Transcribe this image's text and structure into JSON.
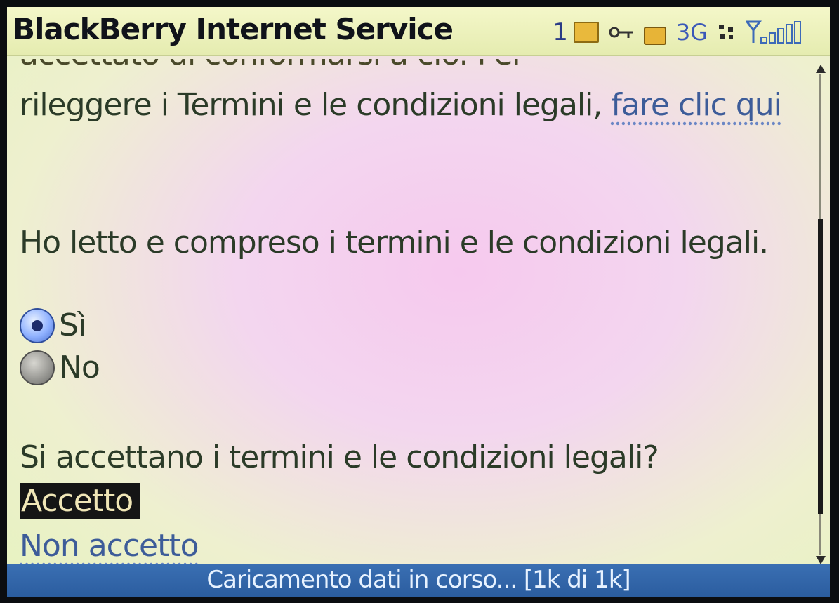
{
  "header": {
    "title": "BlackBerry Internet Service",
    "status": {
      "count": "1",
      "network": "3G",
      "icons": [
        "unread-message-icon",
        "key-icon",
        "lock-icon",
        "data-activity-icon",
        "signal-strength-icon"
      ]
    }
  },
  "content": {
    "partial_line": "accettato di conformarsi a ciò. Per",
    "terms_text": "rileggere i Termini e le condizioni legali, ",
    "terms_link": "fare clic qui",
    "question_read": "Ho letto e compreso i termini e le condizioni legali.",
    "options": [
      {
        "label": "Sì",
        "selected": true
      },
      {
        "label": "No",
        "selected": false
      }
    ],
    "question_accept": "Si accettano i termini e le condizioni legali?",
    "accept_label": "Accetto",
    "reject_label": "Non accetto"
  },
  "statusbar": {
    "text": "Caricamento dati in corso... [1k di 1k]"
  },
  "colors": {
    "title_bar": "#eef3bf",
    "link": "#3d5c99",
    "status_bar": "#3368ac",
    "highlight_bg": "#151515"
  }
}
